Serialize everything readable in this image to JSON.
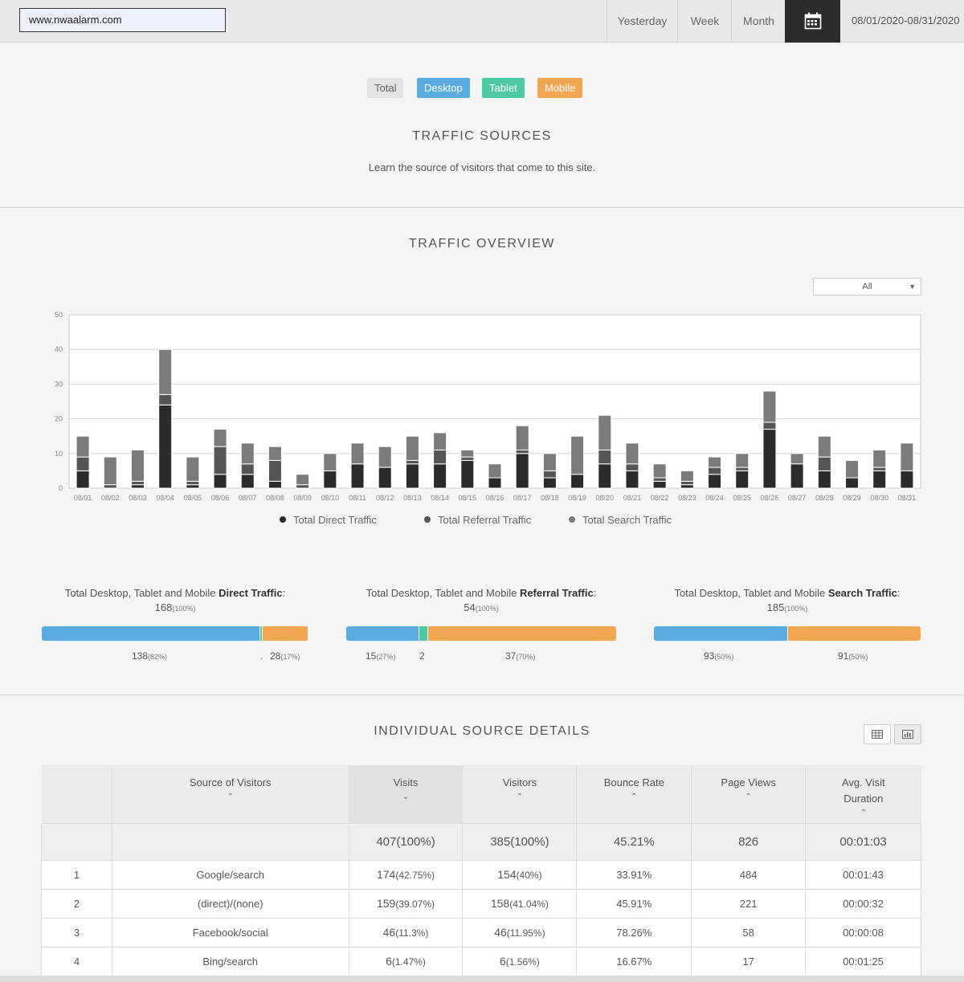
{
  "topbar": {
    "site_url": "www.nwaalarm.com",
    "ranges": [
      "Yesterday",
      "Week",
      "Month"
    ],
    "calendar_icon": "calendar-icon",
    "date_range": "08/01/2020-08/31/2020"
  },
  "device_tabs": [
    {
      "label": "Total",
      "bg": "#e3e4e6",
      "fg": "#666666"
    },
    {
      "label": "Desktop",
      "bg": "#5aabdf",
      "fg": "#ffffff"
    },
    {
      "label": "Tablet",
      "bg": "#4fc9a3",
      "fg": "#ffffff"
    },
    {
      "label": "Mobile",
      "bg": "#f3a652",
      "fg": "#ffffff"
    }
  ],
  "traffic_sources": {
    "title": "TRAFFIC  SOURCES",
    "description": "Learn the source of visitors that come to this site."
  },
  "overview": {
    "title": "TRAFFIC  OVERVIEW",
    "filter_value": "All"
  },
  "chart_data": {
    "type": "bar",
    "stacked": true,
    "categories": [
      "08/01",
      "08/02",
      "08/03",
      "08/04",
      "08/05",
      "08/06",
      "08/07",
      "08/08",
      "08/09",
      "08/10",
      "08/11",
      "08/12",
      "08/13",
      "08/14",
      "08/15",
      "08/16",
      "08/17",
      "08/18",
      "08/19",
      "08/20",
      "08/21",
      "08/22",
      "08/23",
      "08/24",
      "08/25",
      "08/26",
      "08/27",
      "08/28",
      "08/29",
      "08/30",
      "08/31"
    ],
    "series": [
      {
        "name": "Total Direct Traffic",
        "color": "#2b2b2b",
        "values": [
          5,
          0,
          1,
          24,
          1,
          4,
          4,
          2,
          0,
          5,
          7,
          6,
          7,
          7,
          8,
          3,
          10,
          3,
          4,
          7,
          5,
          2,
          1,
          4,
          5,
          17,
          7,
          5,
          3,
          5,
          5
        ]
      },
      {
        "name": "Total Referral Traffic",
        "color": "#555555",
        "values": [
          4,
          1,
          1,
          3,
          1,
          8,
          3,
          6,
          1,
          0,
          0,
          0,
          1,
          4,
          1,
          0,
          1,
          2,
          0,
          4,
          2,
          1,
          1,
          2,
          1,
          2,
          0,
          4,
          0,
          1,
          0
        ]
      },
      {
        "name": "Total Search Traffic",
        "color": "#7b7b7b",
        "values": [
          6,
          8,
          9,
          13,
          7,
          5,
          6,
          4,
          3,
          5,
          6,
          6,
          7,
          5,
          2,
          4,
          7,
          5,
          11,
          10,
          6,
          4,
          3,
          3,
          4,
          9,
          3,
          6,
          5,
          5,
          8
        ]
      }
    ],
    "ylim": [
      0,
      50
    ],
    "yticks": [
      0,
      10,
      20,
      30,
      40,
      50
    ],
    "grid": true,
    "legend": "bottom"
  },
  "summaries": [
    {
      "prefix": "Total Desktop, Tablet and Mobile ",
      "kind": "Direct Traffic",
      "total": "168",
      "total_pct": "(100%)",
      "segments": [
        {
          "device": "desktop",
          "value": "138",
          "pct": "(82%)",
          "fraction": 0.82,
          "color": "#5aabdf"
        },
        {
          "device": "tablet",
          "value": ".",
          "pct": "",
          "fraction": 0.006,
          "color": "#4fc9a3"
        },
        {
          "device": "mobile",
          "value": "28",
          "pct": "(17%)",
          "fraction": 0.17,
          "color": "#f3a652"
        }
      ]
    },
    {
      "prefix": "Total Desktop, Tablet and Mobile ",
      "kind": "Referral Traffic",
      "total": "54",
      "total_pct": "(100%)",
      "segments": [
        {
          "device": "desktop",
          "value": "15",
          "pct": "(27%)",
          "fraction": 0.27,
          "color": "#5aabdf"
        },
        {
          "device": "tablet",
          "value": "2",
          "pct": "",
          "fraction": 0.03,
          "color": "#4fc9a3"
        },
        {
          "device": "mobile",
          "value": "37",
          "pct": "(70%)",
          "fraction": 0.7,
          "color": "#f3a652"
        }
      ]
    },
    {
      "prefix": "Total Desktop, Tablet and Mobile ",
      "kind": "Search Traffic",
      "total": "185",
      "total_pct": "(100%)",
      "segments": [
        {
          "device": "desktop",
          "value": "93",
          "pct": "(50%)",
          "fraction": 0.5,
          "color": "#5aabdf"
        },
        {
          "device": "mobile",
          "value": "91",
          "pct": "(50%)",
          "fraction": 0.5,
          "color": "#f3a652"
        }
      ]
    }
  ],
  "details": {
    "title": "INDIVIDUAL  SOURCE  DETAILS",
    "view_icons": [
      "table-view-icon",
      "chart-view-icon"
    ],
    "columns": [
      {
        "label": "",
        "arrow": ""
      },
      {
        "label": "Source of Visitors",
        "arrow": "⌃"
      },
      {
        "label": "Visits",
        "arrow": "⌄"
      },
      {
        "label": "Visitors",
        "arrow": "⌃"
      },
      {
        "label": "Bounce Rate",
        "arrow": "⌃"
      },
      {
        "label": "Page Views",
        "arrow": "⌃"
      },
      {
        "label": "Avg. Visit Duration",
        "arrow": "⌃"
      }
    ],
    "total_row": {
      "visits": "407(100%)",
      "visitors": "385(100%)",
      "bounce": "45.21%",
      "pageviews": "826",
      "duration": "00:01:03"
    },
    "rows": [
      {
        "rank": "1",
        "source": "Google/search",
        "visits": "174",
        "visits_pct": "(42.75%)",
        "visitors": "154",
        "visitors_pct": "(40%)",
        "bounce": "33.91%",
        "pageviews": "484",
        "duration": "00:01:43"
      },
      {
        "rank": "2",
        "source": "(direct)/(none)",
        "visits": "159",
        "visits_pct": "(39.07%)",
        "visitors": "158",
        "visitors_pct": "(41.04%)",
        "bounce": "45.91%",
        "pageviews": "221",
        "duration": "00:00:32"
      },
      {
        "rank": "3",
        "source": "Facebook/social",
        "visits": "46",
        "visits_pct": "(11.3%)",
        "visitors": "46",
        "visitors_pct": "(11.95%)",
        "bounce": "78.26%",
        "pageviews": "58",
        "duration": "00:00:08"
      },
      {
        "rank": "4",
        "source": "Bing/search",
        "visits": "6",
        "visits_pct": "(1.47%)",
        "visitors": "6",
        "visitors_pct": "(1.56%)",
        "bounce": "16.67%",
        "pageviews": "17",
        "duration": "00:01:25"
      }
    ]
  }
}
